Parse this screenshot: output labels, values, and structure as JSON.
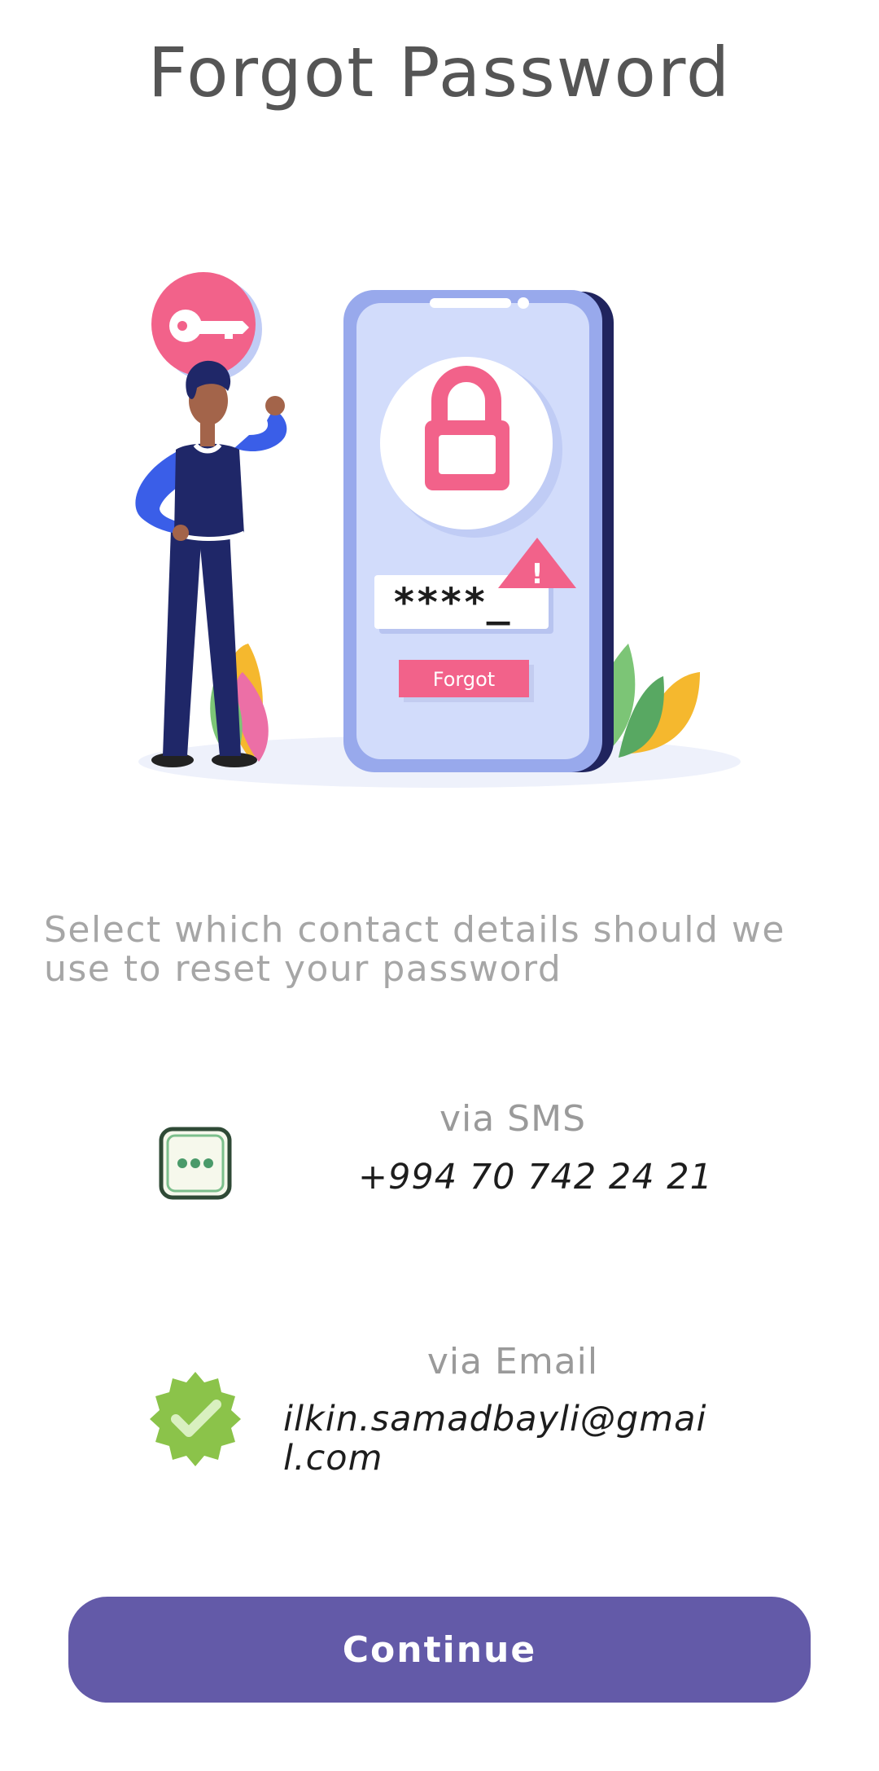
{
  "header": {
    "title": "Forgot Password"
  },
  "illustration": {
    "password_field_text": "****_",
    "forgot_label": "Forgot",
    "alert_glyph": "!"
  },
  "instruction": "Select which contact details should we use to reset your password",
  "options": [
    {
      "icon": "sms-chat-icon",
      "label": "via SMS",
      "value": "+994 70 742 24 21"
    },
    {
      "icon": "verified-check-badge-icon",
      "label": "via Email",
      "value": "ilkin.samadbayli@gmail.com"
    }
  ],
  "footer": {
    "continue_label": "Continue"
  },
  "colors": {
    "accent": "#635aa8",
    "title_text": "#555555",
    "muted_text": "#a6a6a6",
    "pink": "#f2628a",
    "green_check": "#8bc34a"
  }
}
